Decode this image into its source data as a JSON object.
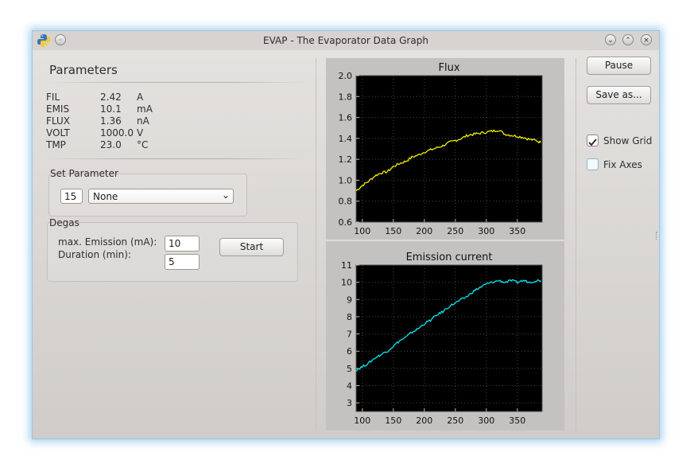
{
  "window": {
    "title": "EVAP - The Evaporator Data Graph",
    "icon": "python-icon",
    "controls": [
      "minimize-icon",
      "maximize-icon",
      "close-icon"
    ]
  },
  "parameters": {
    "heading": "Parameters",
    "rows": [
      {
        "name": "FIL",
        "value": "2.42",
        "unit": "A"
      },
      {
        "name": "EMIS",
        "value": "10.1",
        "unit": "mA"
      },
      {
        "name": "FLUX",
        "value": "1.36",
        "unit": "nA"
      },
      {
        "name": "VOLT",
        "value": "1000.0",
        "unit": "V"
      },
      {
        "name": "TMP",
        "value": "23.0",
        "unit": "°C"
      }
    ]
  },
  "set_parameter": {
    "title": "Set Parameter",
    "value": "15",
    "selected": "None"
  },
  "degas": {
    "title": "Degas",
    "emission_label": "max. Emission (mA):",
    "duration_label": "Duration (min):",
    "emission_value": "10",
    "duration_value": "5",
    "start_label": "Start"
  },
  "controls": {
    "pause_label": "Pause",
    "save_label": "Save as...",
    "show_grid_label": "Show Grid",
    "show_grid_checked": true,
    "fix_axes_label": "Fix Axes",
    "fix_axes_checked": false
  },
  "colors": {
    "flux_line": "#f0f000",
    "emission_line": "#00e8f0",
    "plot_background": "#000000",
    "window_glow": "#5aaae1"
  },
  "chart_data": [
    {
      "type": "line",
      "title": "Flux",
      "xlabel": "",
      "ylabel": "",
      "xlim": [
        90,
        390
      ],
      "ylim": [
        0.6,
        2.0
      ],
      "xticks": [
        100,
        150,
        200,
        250,
        300,
        350
      ],
      "yticks": [
        0.6,
        0.8,
        1.0,
        1.2,
        1.4,
        1.6,
        1.8,
        2.0
      ],
      "grid": true,
      "series": [
        {
          "x": [
            90,
            100,
            110,
            120,
            130,
            140,
            150,
            160,
            170,
            180,
            190,
            200,
            210,
            220,
            230,
            240,
            250,
            260,
            270,
            280,
            290,
            300,
            310,
            320,
            330,
            340,
            350,
            360,
            370,
            380,
            388
          ],
          "y": [
            0.9,
            0.95,
            0.99,
            1.04,
            1.07,
            1.08,
            1.13,
            1.16,
            1.18,
            1.22,
            1.24,
            1.27,
            1.29,
            1.31,
            1.33,
            1.36,
            1.38,
            1.4,
            1.43,
            1.44,
            1.45,
            1.46,
            1.47,
            1.48,
            1.44,
            1.43,
            1.42,
            1.41,
            1.39,
            1.38,
            1.36
          ]
        }
      ]
    },
    {
      "type": "line",
      "title": "Emission current",
      "xlabel": "",
      "ylabel": "",
      "xlim": [
        90,
        390
      ],
      "ylim": [
        2.5,
        11
      ],
      "xticks": [
        100,
        150,
        200,
        250,
        300,
        350
      ],
      "yticks": [
        3,
        4,
        5,
        6,
        7,
        8,
        9,
        10,
        11
      ],
      "grid": true,
      "series": [
        {
          "x": [
            90,
            100,
            110,
            120,
            130,
            140,
            150,
            160,
            170,
            180,
            190,
            200,
            210,
            220,
            230,
            240,
            250,
            260,
            270,
            280,
            290,
            300,
            310,
            320,
            330,
            340,
            350,
            360,
            370,
            380,
            388
          ],
          "y": [
            4.9,
            5.1,
            5.3,
            5.6,
            5.8,
            6.0,
            6.3,
            6.6,
            6.8,
            7.1,
            7.3,
            7.6,
            7.8,
            8.1,
            8.3,
            8.6,
            8.8,
            9.0,
            9.2,
            9.5,
            9.7,
            9.9,
            10.0,
            10.1,
            10.0,
            10.1,
            10.0,
            10.1,
            10.0,
            10.1,
            10.1
          ]
        }
      ]
    }
  ]
}
